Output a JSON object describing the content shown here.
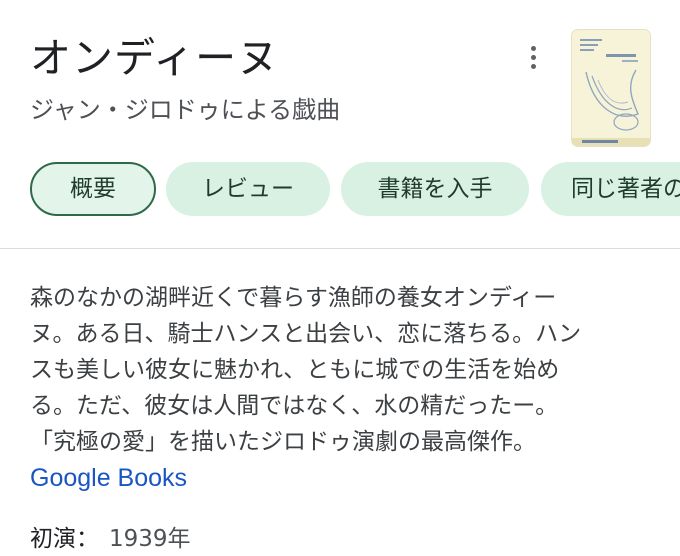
{
  "header": {
    "title": "オンディーヌ",
    "subtitle": "ジャン・ジロドゥによる戯曲",
    "more_icon": "more-vert-icon",
    "cover_image": "book-cover-thumbnail"
  },
  "tabs": [
    {
      "label": "概要",
      "selected": true
    },
    {
      "label": "レビュー",
      "selected": false
    },
    {
      "label": "書籍を入手",
      "selected": false
    },
    {
      "label": "同じ著者の",
      "selected": false
    }
  ],
  "description": {
    "lines": [
      "森のなかの湖畔近くで暮らす漁師の養女オンディー",
      "ヌ。ある日、騎士ハンスと出会い、恋に落ちる。ハン",
      "スも美しい彼女に魅かれ、ともに城での生活を始め",
      "る。ただ、彼女は人間ではなく、水の精だったー。",
      "「究極の愛」を描いたジロドゥ演劇の最高傑作。"
    ],
    "source": "Google Books"
  },
  "facts": {
    "premiere_label": "初演：",
    "premiere_value": "1939年"
  },
  "colors": {
    "chip_bg": "#d8f1e3",
    "chip_selected_border": "#2d6a47",
    "link": "#1a55c4"
  }
}
